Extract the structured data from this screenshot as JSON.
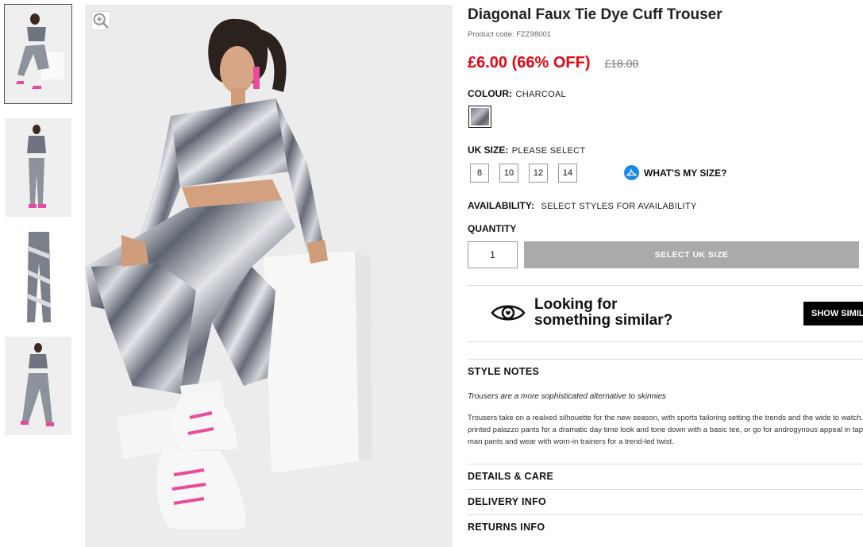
{
  "product": {
    "title": "Diagonal Faux Tie Dye Cuff Trouser",
    "code": "Product code: FZZ98001",
    "price_now": "£6.00 (66% OFF)",
    "price_was": "£18.00"
  },
  "colour": {
    "label": "COLOUR:",
    "value": "CHARCOAL"
  },
  "size": {
    "label": "UK SIZE:",
    "value": "PLEASE SELECT",
    "options": [
      "8",
      "10",
      "12",
      "14"
    ],
    "help_label": "WHAT'S MY SIZE?"
  },
  "availability": {
    "label": "AVAILABILITY:",
    "value": "SELECT STYLES FOR AVAILABILITY"
  },
  "quantity": {
    "label": "QUANTITY",
    "value": "1"
  },
  "add_button": "SELECT UK SIZE",
  "similar": {
    "line1": "Looking for",
    "line2": "something similar?",
    "button": "SHOW SIMILAR"
  },
  "sections": {
    "style_notes": "STYLE NOTES",
    "style_subtitle": "Trousers are a more sophisticated alternative to skinnies",
    "style_body": "Trousers take on a realxed silhouette for the new season, with sports tailoring setting the trends and the wide to watch. Pick printed palazzo pants for a dramatic day time look and tone down with a basic tee, or go for androgynous appeal in tapered man pants and wear with worn-in trainers for a trend-led twist.",
    "details": "DETAILS & CARE",
    "delivery": "DELIVERY INFO",
    "returns": "RETURNS INFO"
  },
  "colors": {
    "sale_red": "#e30613",
    "size_help_blue": "#1e88e5",
    "disabled_button": "#aaaaaa"
  },
  "icons": {
    "zoom": "zoom-icon",
    "hanger": "hanger-icon",
    "eye": "eye-icon"
  }
}
